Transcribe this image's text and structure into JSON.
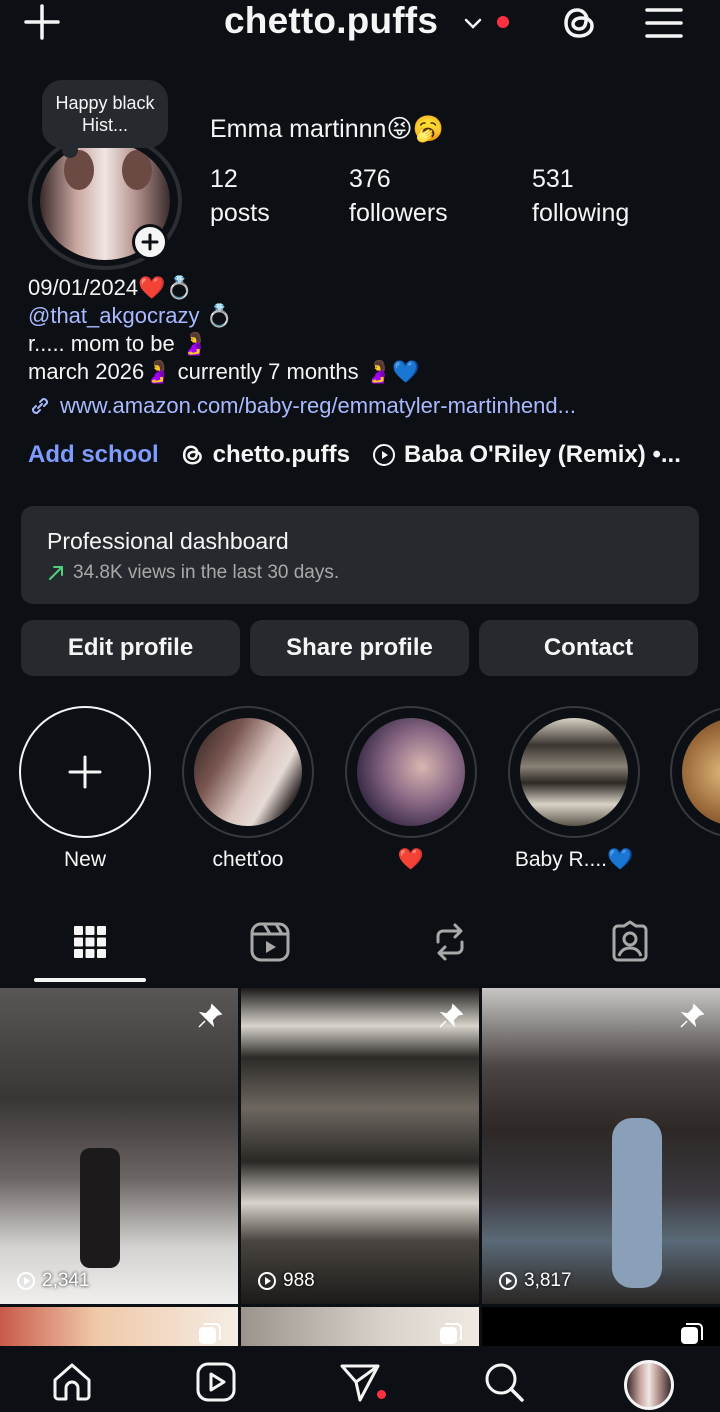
{
  "header": {
    "username": "chetto.puffs",
    "icons": [
      "plus-icon",
      "chevron-down-icon",
      "threads-icon",
      "menu-icon"
    ],
    "notification_dot_color": "#ff3040"
  },
  "profile": {
    "note": "Happy black Hist...",
    "full_name": "Emma martinnn😝🥱",
    "stats": [
      {
        "value": "12",
        "label": "posts"
      },
      {
        "value": "376",
        "label": "followers"
      },
      {
        "value": "531",
        "label": "following"
      }
    ]
  },
  "bio": {
    "line1": "09/01/2024❤️💍",
    "mention": "@that_akgocrazy",
    "mention_suffix": " 💍",
    "line3": "r..... mom to be 🤰",
    "line4": "march 2026🤰 currently 7 months 🤰💙",
    "link": "www.amazon.com/baby-reg/emmatyler-martinhend..."
  },
  "chips": {
    "add_school": "Add school",
    "threads": "chetto.puffs",
    "music": "Baba O'Riley (Remix) •..."
  },
  "dashboard": {
    "title": "Professional dashboard",
    "subtitle": "34.8K views in the last 30 days."
  },
  "buttons": {
    "edit": "Edit profile",
    "share": "Share profile",
    "contact": "Contact"
  },
  "highlights": [
    {
      "label": "New"
    },
    {
      "label": "chetťoo"
    },
    {
      "label": "❤️"
    },
    {
      "label": "Baby R....💙"
    }
  ],
  "tabs": [
    "grid-icon",
    "reels-icon",
    "reposts-icon",
    "tagged-icon"
  ],
  "posts": [
    {
      "views": "2,341",
      "pinned": true
    },
    {
      "views": "988",
      "pinned": true
    },
    {
      "views": "3,817",
      "pinned": true
    }
  ],
  "colors": {
    "background": "#0c1014",
    "surface": "#262a2f",
    "link": "#a8b9ff",
    "accent_blue": "#7e9bff"
  }
}
